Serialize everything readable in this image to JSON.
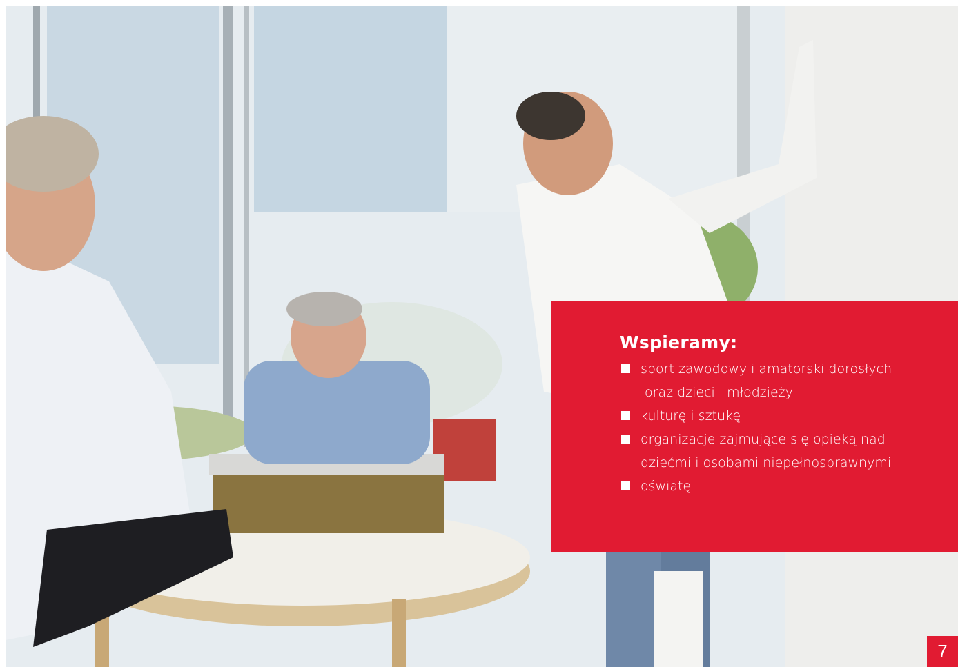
{
  "info_box": {
    "title": "Wspieramy:",
    "items": [
      {
        "line1": "sport zawodowy i amatorski dorosłych",
        "line2": "oraz dzieci i młodzieży"
      },
      {
        "line1": "kulturę i sztukę",
        "line2": ""
      },
      {
        "line1": "organizacje zajmujące się opieką nad",
        "line2": "dziećmi i osobami niepełnosprawnymi"
      },
      {
        "line1": "oświatę",
        "line2": ""
      }
    ]
  },
  "page_number": "7",
  "colors": {
    "accent_red": "#e11b32",
    "text_on_red": "#ffffff"
  }
}
